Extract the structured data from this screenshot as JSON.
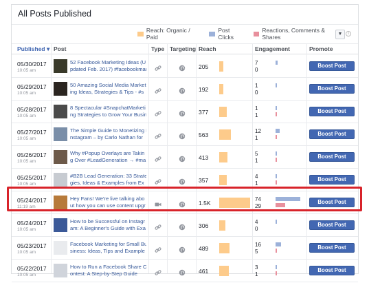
{
  "title": "All Posts Published",
  "legend": {
    "reach": "Reach: Organic / Paid",
    "clicks": "Post Clicks",
    "reactions": "Reactions, Comments & Shares",
    "reach_color": "#fdcb8b",
    "clicks_color": "#9cb1d9",
    "reactions_color": "#e8909d",
    "info_icon": "i"
  },
  "headers": {
    "published": "Published ▾",
    "post": "Post",
    "type": "Type",
    "targeting": "Targeting",
    "reach": "Reach",
    "engagement": "Engagement",
    "promote": "Promote"
  },
  "rows": [
    {
      "date": "05/30/2017",
      "time": "10:05 am",
      "line1": "52 Facebook Marketing Ideas (U",
      "line2": "pdated Feb. 2017) #facebookmar",
      "reach": "205",
      "reach_value": 205,
      "eng1": "7",
      "eng2": "0",
      "clicks": 7,
      "reactions": 0,
      "type": "link-icon",
      "boost": "Boost Post",
      "thumb": "#3a3a2a"
    },
    {
      "date": "05/29/2017",
      "time": "10:05 am",
      "line1": "50 Amazing Social Media Market",
      "line2": "ing Ideas, Strategies & Tips - #s",
      "reach": "192",
      "reach_value": 192,
      "eng1": "1",
      "eng2": "0",
      "clicks": 1,
      "reactions": 0,
      "type": "link-icon",
      "boost": "Boost Post",
      "thumb": "#2b2520"
    },
    {
      "date": "05/28/2017",
      "time": "10:05 am",
      "line1": "8 Spectacular #SnapchatMarketi",
      "line2": "ng Strategies to Grow Your Busin",
      "reach": "377",
      "reach_value": 377,
      "eng1": "1",
      "eng2": "1",
      "clicks": 1,
      "reactions": 1,
      "type": "link-icon",
      "boost": "Boost Post",
      "thumb": "#4a4a4a"
    },
    {
      "date": "05/27/2017",
      "time": "10:05 am",
      "line1": "The Simple Guide to Monetizing I",
      "line2": "nstagram – by Carlo Nathan for",
      "reach": "563",
      "reach_value": 563,
      "eng1": "12",
      "eng2": "1",
      "clicks": 12,
      "reactions": 1,
      "type": "link-icon",
      "boost": "Boost Post",
      "thumb": "#7a8ea8"
    },
    {
      "date": "05/26/2017",
      "time": "10:05 am",
      "line1": "Why #Popup Overlays are Takin",
      "line2": "g Over #LeadGeneration → #ma",
      "reach": "413",
      "reach_value": 413,
      "eng1": "5",
      "eng2": "1",
      "clicks": 5,
      "reactions": 1,
      "type": "link-icon",
      "boost": "Boost Post",
      "thumb": "#6d5a4a"
    },
    {
      "date": "05/25/2017",
      "time": "10:05 am",
      "line1": "#B2B Lead Generation: 33 Strate",
      "line2": "gies, Ideas & Examples from Ex",
      "reach": "357",
      "reach_value": 357,
      "eng1": "4",
      "eng2": "1",
      "clicks": 4,
      "reactions": 1,
      "type": "link-icon",
      "boost": "Boost Post",
      "thumb": "#c7cbd1"
    },
    {
      "date": "05/24/2017",
      "time": "11:19 am",
      "line1": "Hey Fans! We're live talking abo",
      "line2": "ut how you can use content upgr",
      "reach": "1.5K",
      "reach_value": 1500,
      "eng1": "74",
      "eng2": "29",
      "clicks": 74,
      "reactions": 29,
      "type": "video-icon",
      "boost": "Boost Post",
      "thumb": "#b77a3a"
    },
    {
      "date": "05/24/2017",
      "time": "10:05 am",
      "line1": "How to be Successful on Instagr",
      "line2": "am: A Beginner's Guide with Exa",
      "reach": "306",
      "reach_value": 306,
      "eng1": "4",
      "eng2": "0",
      "clicks": 4,
      "reactions": 0,
      "type": "link-icon",
      "boost": "Boost Post",
      "thumb": "#3b5998"
    },
    {
      "date": "05/23/2017",
      "time": "10:05 am",
      "line1": "Facebook Marketing for Small Bu",
      "line2": "siness: Ideas, Tips and Example",
      "reach": "489",
      "reach_value": 489,
      "eng1": "16",
      "eng2": "5",
      "clicks": 16,
      "reactions": 5,
      "type": "link-icon",
      "boost": "Boost Post",
      "thumb": "#e9ebee"
    },
    {
      "date": "05/22/2017",
      "time": "10:05 am",
      "line1": "How to Run a Facebook Share C",
      "line2": "ontest: A Step-by-Step Guide",
      "reach": "461",
      "reach_value": 461,
      "eng1": "3",
      "eng2": "1",
      "clicks": 3,
      "reactions": 1,
      "type": "link-icon",
      "boost": "Boost Post",
      "thumb": "#d0d4db"
    }
  ]
}
